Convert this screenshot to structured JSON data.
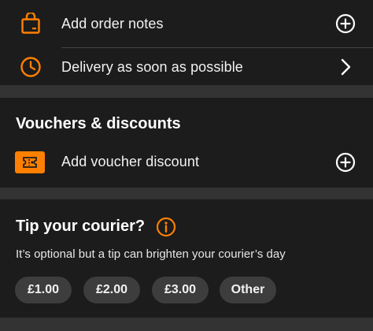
{
  "order_notes": {
    "label": "Add order notes",
    "icon": "bag-icon",
    "action_icon": "plus-circle-icon"
  },
  "delivery": {
    "label": "Delivery as soon as possible",
    "icon": "clock-icon",
    "action_icon": "chevron-right-icon"
  },
  "vouchers": {
    "title": "Vouchers & discounts",
    "add_label": "Add voucher discount",
    "icon": "voucher-ticket-icon",
    "action_icon": "plus-circle-icon"
  },
  "tip": {
    "title": "Tip your courier?",
    "info_icon": "info-icon",
    "description": "It’s optional but a tip can brighten your courier’s day",
    "options": [
      "£1.00",
      "£2.00",
      "£3.00",
      "Other"
    ]
  },
  "colors": {
    "accent": "#ff8000",
    "background": "#1c1c1c",
    "separator": "#333333",
    "chip": "#3d3d3d",
    "text": "#ffffff"
  }
}
